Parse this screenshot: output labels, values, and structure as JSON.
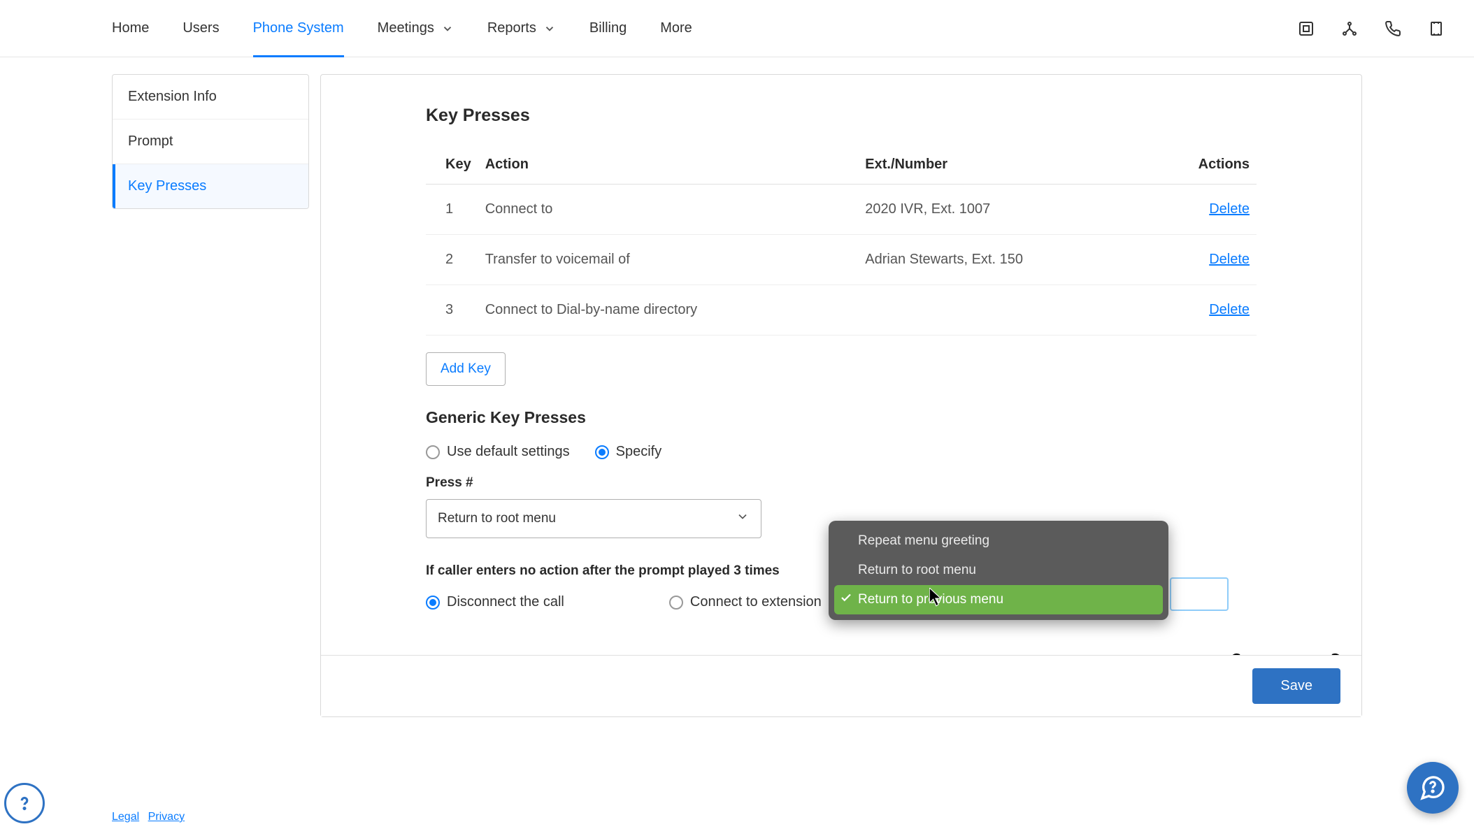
{
  "nav": {
    "items": [
      {
        "label": "Home"
      },
      {
        "label": "Users"
      },
      {
        "label": "Phone System"
      },
      {
        "label": "Meetings"
      },
      {
        "label": "Reports"
      },
      {
        "label": "Billing"
      },
      {
        "label": "More"
      }
    ]
  },
  "sidebar": {
    "items": [
      {
        "label": "Extension Info"
      },
      {
        "label": "Prompt"
      },
      {
        "label": "Key Presses"
      }
    ]
  },
  "main": {
    "title": "Key Presses",
    "columns": {
      "key": "Key",
      "action": "Action",
      "ext": "Ext./Number",
      "actions": "Actions"
    },
    "rows": [
      {
        "key": "1",
        "action": "Connect to",
        "ext": "2020 IVR, Ext. 1007",
        "delete": "Delete"
      },
      {
        "key": "2",
        "action": "Transfer to voicemail of",
        "ext": "Adrian Stewarts, Ext. 150",
        "delete": "Delete"
      },
      {
        "key": "3",
        "action": "Connect to Dial-by-name directory",
        "ext": "",
        "delete": "Delete"
      }
    ],
    "add_key": "Add Key",
    "generic_title": "Generic Key Presses",
    "radios": {
      "use_default": "Use default settings",
      "specify": "Specify"
    },
    "press_label": "Press #",
    "press_select_value": "Return to root menu",
    "noaction_label": "If caller enters no action after the prompt played 3 times",
    "noaction_radios": {
      "disconnect": "Disconnect the call",
      "connect": "Connect to extension"
    },
    "save": "Save"
  },
  "dropdown": {
    "options": [
      {
        "label": "Repeat menu greeting"
      },
      {
        "label": "Return to root menu"
      },
      {
        "label": "Return to previous menu"
      }
    ]
  },
  "footer": {
    "legal": "Legal",
    "privacy": "Privacy"
  }
}
